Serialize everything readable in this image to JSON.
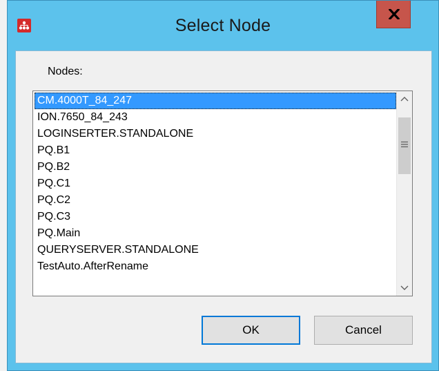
{
  "window": {
    "title": "Select Node",
    "app_icon": "network-nodes-icon",
    "close_icon": "close-icon"
  },
  "nodes_label": "Nodes:",
  "nodes": [
    "CM.4000T_84_247",
    "ION.7650_84_243",
    "LOGINSERTER.STANDALONE",
    "PQ.B1",
    "PQ.B2",
    "PQ.C1",
    "PQ.C2",
    "PQ.C3",
    "PQ.Main",
    "QUERYSERVER.STANDALONE",
    "TestAuto.AfterRename"
  ],
  "selected_index": 0,
  "buttons": {
    "ok": "OK",
    "cancel": "Cancel"
  },
  "colors": {
    "titlebar": "#5cc2ec",
    "selection": "#3399ff",
    "close_button": "#c6554b",
    "app_icon": "#d42a2a"
  }
}
